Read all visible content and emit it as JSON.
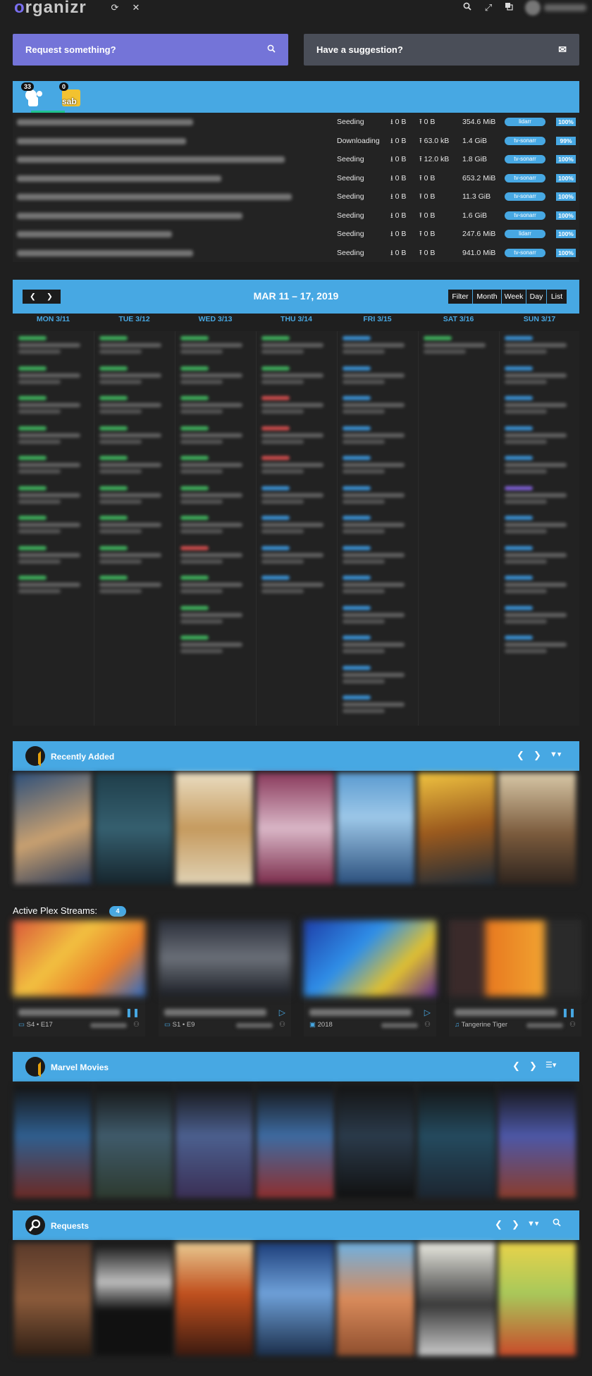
{
  "app": {
    "logo_text": "organizr"
  },
  "header": {
    "icons": [
      "refresh-icon",
      "close-icon",
      "search-icon",
      "fullscreen-icon",
      "translate-icon"
    ]
  },
  "request_bar": {
    "request_label": "Request something?",
    "suggest_label": "Have a suggestion?",
    "colors": {
      "request": "#7474d8",
      "suggest": "#4a4e58"
    }
  },
  "downloader": {
    "tabs": [
      {
        "name": "plex-tab",
        "badge": "33"
      },
      {
        "name": "sab-tab",
        "badge": "0",
        "label": "sab"
      }
    ],
    "rows": [
      {
        "status": "Seeding",
        "down": "0 B",
        "up": "0 B",
        "size": "354.6 MiB",
        "category": "lidarr",
        "progress": "100%"
      },
      {
        "status": "Downloading",
        "down": "0 B",
        "up": "63.0 kB",
        "size": "1.4 GiB",
        "category": "tv-sonarr",
        "progress": "99%"
      },
      {
        "status": "Seeding",
        "down": "0 B",
        "up": "12.0 kB",
        "size": "1.8 GiB",
        "category": "tv-sonarr",
        "progress": "100%"
      },
      {
        "status": "Seeding",
        "down": "0 B",
        "up": "0 B",
        "size": "653.2 MiB",
        "category": "tv-sonarr",
        "progress": "100%"
      },
      {
        "status": "Seeding",
        "down": "0 B",
        "up": "0 B",
        "size": "11.3 GiB",
        "category": "tv-sonarr",
        "progress": "100%"
      },
      {
        "status": "Seeding",
        "down": "0 B",
        "up": "0 B",
        "size": "1.6 GiB",
        "category": "tv-sonarr",
        "progress": "100%"
      },
      {
        "status": "Seeding",
        "down": "0 B",
        "up": "0 B",
        "size": "247.6 MiB",
        "category": "lidarr",
        "progress": "100%"
      },
      {
        "status": "Seeding",
        "down": "0 B",
        "up": "0 B",
        "size": "941.0 MiB",
        "category": "tv-sonarr",
        "progress": "100%"
      }
    ]
  },
  "calendar": {
    "title": "MAR 11 – 17, 2019",
    "views": [
      "Filter",
      "Month",
      "Week",
      "Day",
      "List"
    ],
    "days": [
      "MON 3/11",
      "TUE 3/12",
      "WED 3/13",
      "THU 3/14",
      "FRI 3/15",
      "SAT 3/16",
      "SUN 3/17"
    ]
  },
  "recently_added": {
    "title": "Recently Added"
  },
  "streams": {
    "label": "Active Plex Streams:",
    "count": "4",
    "items": [
      {
        "meta": "S4 • E17",
        "type_icon": "tv-icon",
        "control_icon": "pause-icon"
      },
      {
        "meta": "S1 • E9",
        "type_icon": "tv-icon",
        "control_icon": "play-icon"
      },
      {
        "meta": "2018",
        "type_icon": "film-icon",
        "control_icon": "play-icon"
      },
      {
        "meta": "Tangerine Tiger",
        "type_icon": "music-icon",
        "control_icon": "pause-icon"
      }
    ]
  },
  "marvel": {
    "title": "Marvel Movies"
  },
  "requests": {
    "title": "Requests"
  },
  "accent": "#47a8e3"
}
